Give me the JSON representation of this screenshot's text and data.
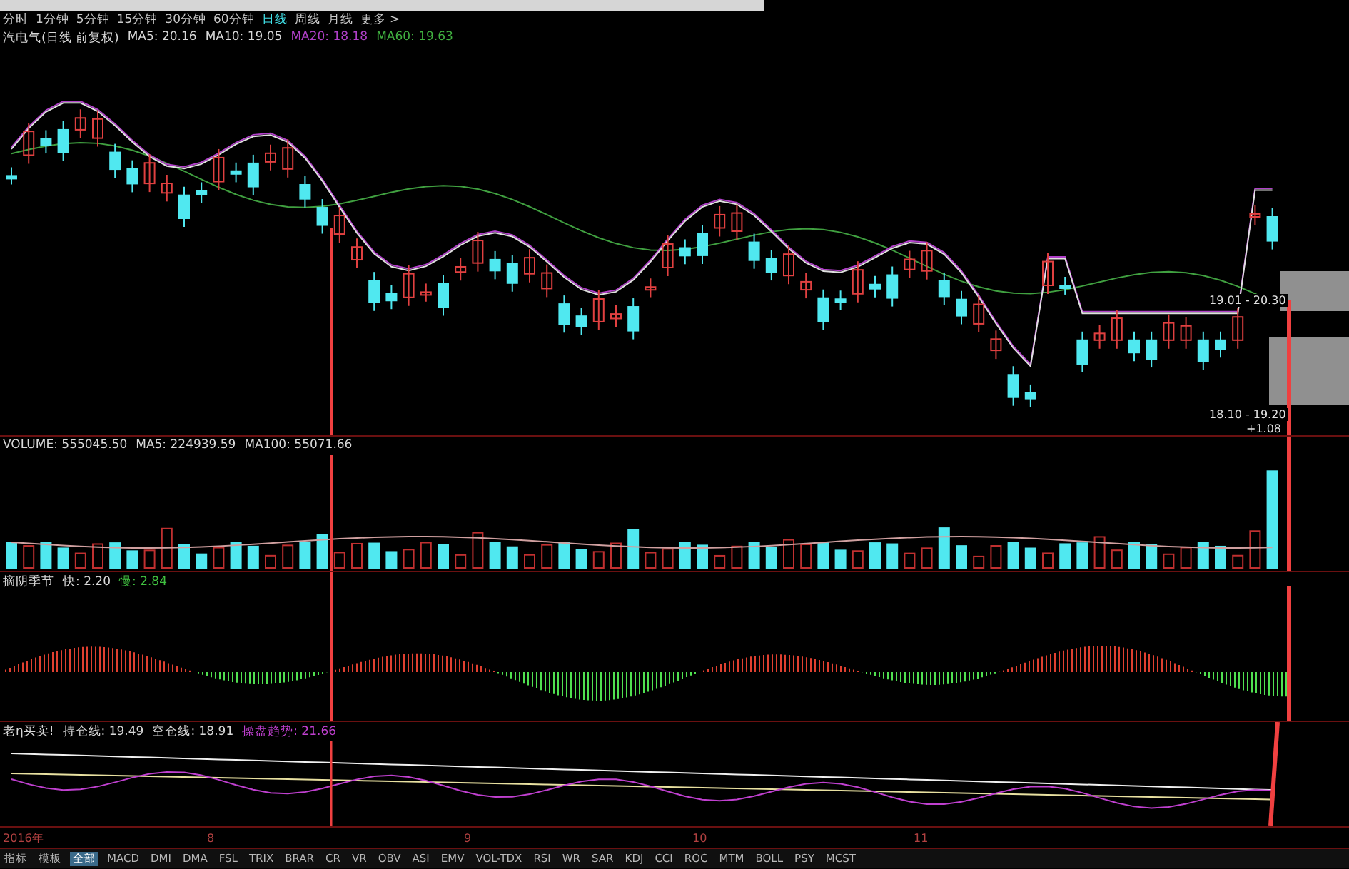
{
  "period_tabs": [
    {
      "label": "分时",
      "selected": false
    },
    {
      "label": "1分钟",
      "selected": false
    },
    {
      "label": "5分钟",
      "selected": false
    },
    {
      "label": "15分钟",
      "selected": false
    },
    {
      "label": "30分钟",
      "selected": false
    },
    {
      "label": "60分钟",
      "selected": false
    },
    {
      "label": "日线",
      "selected": true
    },
    {
      "label": "周线",
      "selected": false
    },
    {
      "label": "月线",
      "selected": false
    },
    {
      "label": "更多 >",
      "selected": false
    }
  ],
  "price_panel": {
    "title": "汽电气(日线 前复权)",
    "legend": [
      {
        "label": "MA5: 20.16",
        "color": "#d8d8d8"
      },
      {
        "label": "MA10: 19.05",
        "color": "#d8d8d8"
      },
      {
        "label": "MA20: 18.18",
        "color": "#b040c8"
      },
      {
        "label": "MA60: 19.63",
        "color": "#40b040"
      }
    ],
    "range_labels": [
      "19.01 - 20.30",
      "18.10 - 19.20",
      "+1.08"
    ]
  },
  "volume_panel": {
    "legend": [
      {
        "label": "VOLUME: 555045.50",
        "color": "#d8d8d8"
      },
      {
        "label": "MA5: 224939.59",
        "color": "#d8d8d8"
      },
      {
        "label": "MA100: 55071.66",
        "color": "#d8d8d8"
      }
    ]
  },
  "oscillator_panel": {
    "title": "摘阴季节",
    "legend": [
      {
        "label": "快: 2.20",
        "color": "#d8d8d8"
      },
      {
        "label": "慢: 2.84",
        "color": "#40c040"
      }
    ]
  },
  "trend_panel": {
    "title": "老η买卖!",
    "legend": [
      {
        "label": "持仓线: 19.49",
        "color": "#d8d8d8"
      },
      {
        "label": "空仓线: 18.91",
        "color": "#d8d8d8"
      },
      {
        "label": "操盘趋势: 21.66",
        "color": "#c040d0"
      }
    ]
  },
  "date_axis": [
    "2016年",
    "8",
    "9",
    "10",
    "11"
  ],
  "indicator_tabs": [
    {
      "label": "指标",
      "selected": false
    },
    {
      "label": "模板",
      "selected": false
    },
    {
      "label": "全部",
      "selected": true
    },
    {
      "label": "MACD",
      "selected": false
    },
    {
      "label": "DMI",
      "selected": false
    },
    {
      "label": "DMA",
      "selected": false
    },
    {
      "label": "FSL",
      "selected": false
    },
    {
      "label": "TRIX",
      "selected": false
    },
    {
      "label": "BRAR",
      "selected": false
    },
    {
      "label": "CR",
      "selected": false
    },
    {
      "label": "VR",
      "selected": false
    },
    {
      "label": "OBV",
      "selected": false
    },
    {
      "label": "ASI",
      "selected": false
    },
    {
      "label": "EMV",
      "selected": false
    },
    {
      "label": "VOL-TDX",
      "selected": false
    },
    {
      "label": "RSI",
      "selected": false
    },
    {
      "label": "WR",
      "selected": false
    },
    {
      "label": "SAR",
      "selected": false
    },
    {
      "label": "KDJ",
      "selected": false
    },
    {
      "label": "CCI",
      "selected": false
    },
    {
      "label": "ROC",
      "selected": false
    },
    {
      "label": "MTM",
      "selected": false
    },
    {
      "label": "BOLL",
      "selected": false
    },
    {
      "label": "PSY",
      "selected": false
    },
    {
      "label": "MCST",
      "selected": false
    }
  ]
}
